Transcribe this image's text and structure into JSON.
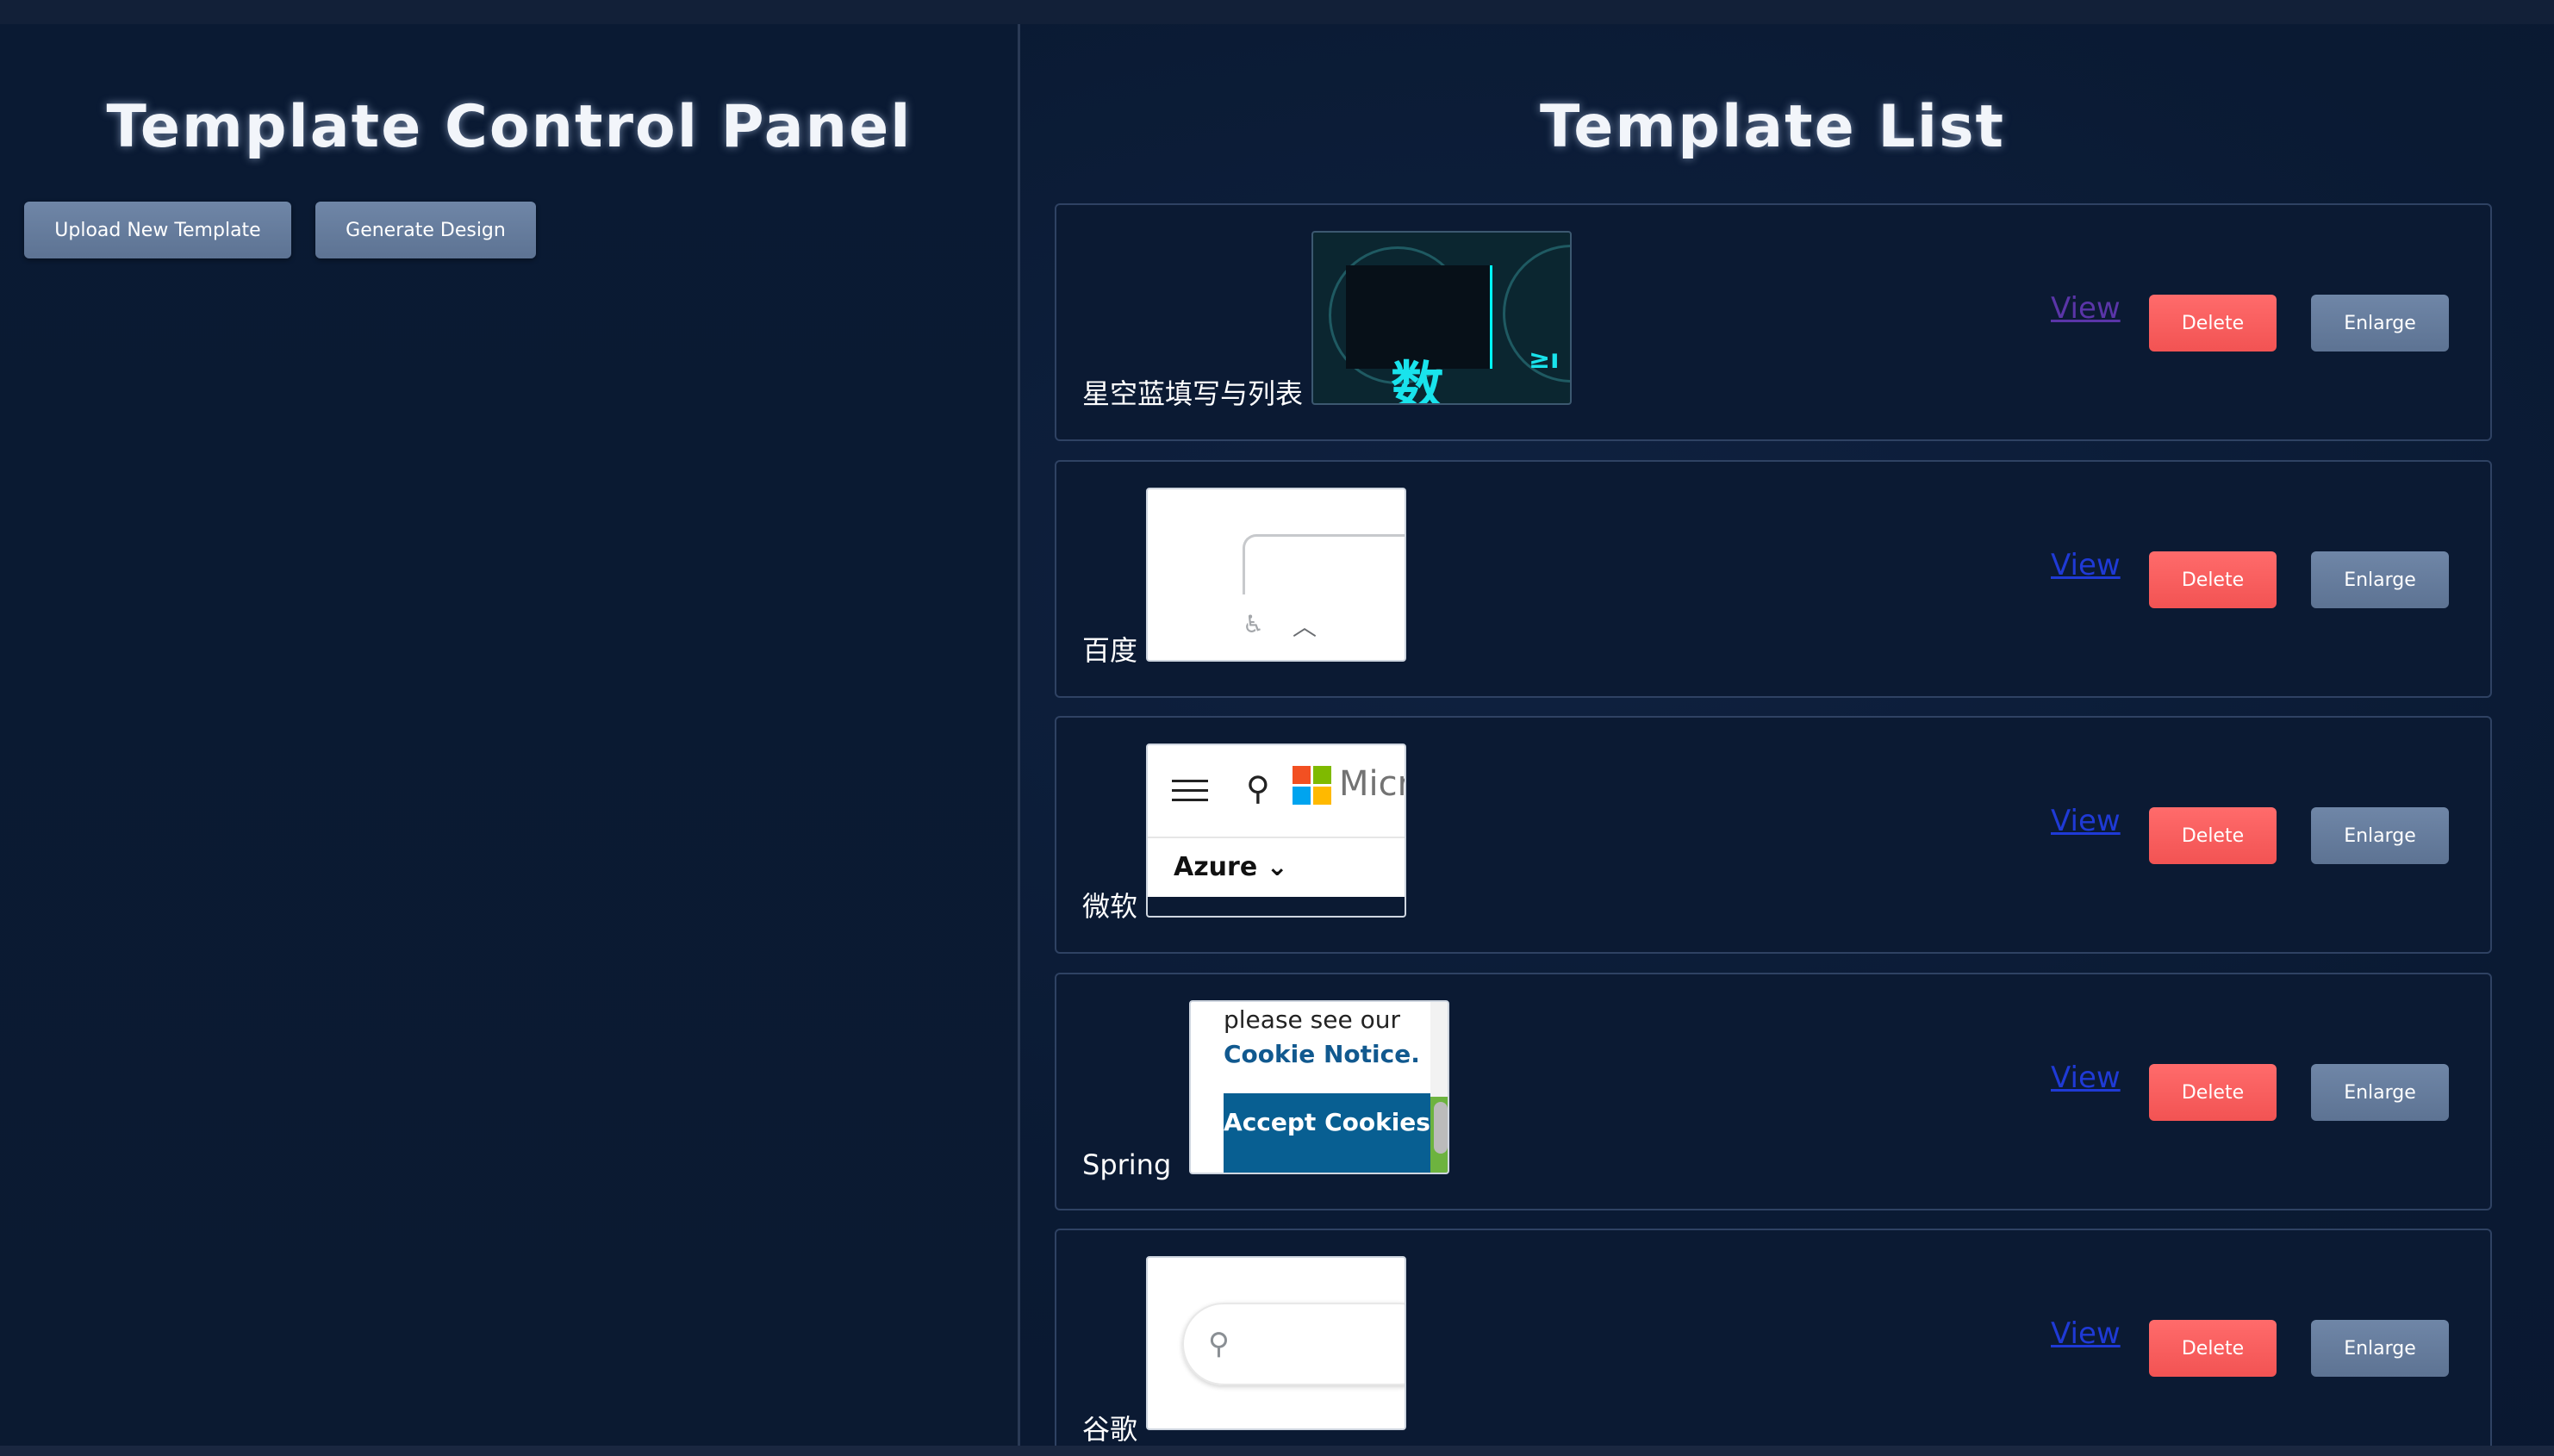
{
  "left_panel": {
    "title": "Template Control Panel",
    "upload_label": "Upload New Template",
    "generate_label": "Generate Design"
  },
  "right_panel": {
    "title": "Template List"
  },
  "templates": [
    {
      "name": "星空蓝填写与列表",
      "view_label": "View",
      "delete_label": "Delete",
      "enlarge_label": "Enlarge",
      "thumb": {
        "glyph": "数",
        "glyph2": "≥ı"
      }
    },
    {
      "name": "百度",
      "view_label": "View",
      "delete_label": "Delete",
      "enlarge_label": "Enlarge"
    },
    {
      "name": "微软",
      "view_label": "View",
      "delete_label": "Delete",
      "enlarge_label": "Enlarge",
      "thumb": {
        "brand": "Micr",
        "menu": "Azure"
      }
    },
    {
      "name": "Spring",
      "view_label": "View",
      "delete_label": "Delete",
      "enlarge_label": "Enlarge",
      "thumb": {
        "line1": "please see our",
        "line2": "Cookie Notice.",
        "button": "Accept Cookies"
      }
    },
    {
      "name": "谷歌",
      "view_label": "View",
      "delete_label": "Delete",
      "enlarge_label": "Enlarge"
    }
  ],
  "colors": {
    "background": "#0b1a33",
    "delete": "#ff6b6b",
    "steel_button": "#6f86a7",
    "link": "#1f3ad6",
    "link_visited": "#5a35a8",
    "accent_cyan": "#19e3ec"
  },
  "icons": [
    "hamburger-icon",
    "search-icon",
    "microsoft-logo-icon",
    "chevron-down-icon",
    "accessibility-icon",
    "chevron-up-icon"
  ]
}
